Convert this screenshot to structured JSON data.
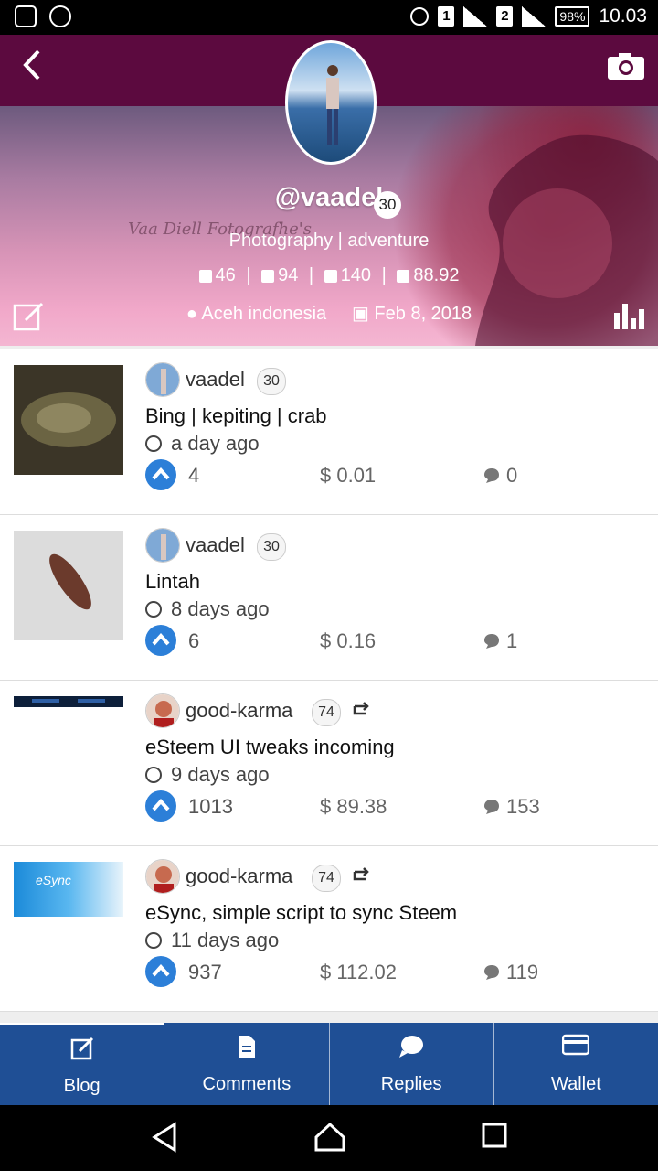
{
  "status_bar": {
    "sim1": "1",
    "sim2": "2",
    "battery": "98%",
    "time": "10.03"
  },
  "profile": {
    "username": "@vaadel",
    "reputation": "30",
    "watermark": "Vaa Diell Fotografhe's",
    "about": "Photography | adventure",
    "stats": {
      "posts": "46",
      "followers": "94",
      "following": "140",
      "voting_power": "88.92"
    },
    "location": "Aceh indonesia",
    "joined": "Feb 8, 2018"
  },
  "posts": [
    {
      "author": "vaadel",
      "reputation": "30",
      "resteemed": false,
      "title": "Bing | kepiting | crab",
      "time": "a day ago",
      "votes": "4",
      "payout": "$ 0.01",
      "comments": "0"
    },
    {
      "author": "vaadel",
      "reputation": "30",
      "resteemed": false,
      "title": "Lintah",
      "time": "8 days ago",
      "votes": "6",
      "payout": "$ 0.16",
      "comments": "1"
    },
    {
      "author": "good-karma",
      "reputation": "74",
      "resteemed": true,
      "title": "eSteem UI tweaks incoming",
      "time": "9 days ago",
      "votes": "1013",
      "payout": "$ 89.38",
      "comments": "153"
    },
    {
      "author": "good-karma",
      "reputation": "74",
      "resteemed": true,
      "title": "eSync, simple script to sync Steem",
      "time": "11 days ago",
      "votes": "937",
      "payout": "$ 112.02",
      "comments": "119",
      "thumb_text": "eSync"
    }
  ],
  "tabs": [
    {
      "label": "Blog",
      "icon": "edit-icon"
    },
    {
      "label": "Comments",
      "icon": "document-icon"
    },
    {
      "label": "Replies",
      "icon": "speech-bubble-icon"
    },
    {
      "label": "Wallet",
      "icon": "credit-card-icon"
    }
  ],
  "colors": {
    "header": "#5c0a3f",
    "tabbar": "#1f4f95",
    "vote": "#2c7fd8"
  }
}
